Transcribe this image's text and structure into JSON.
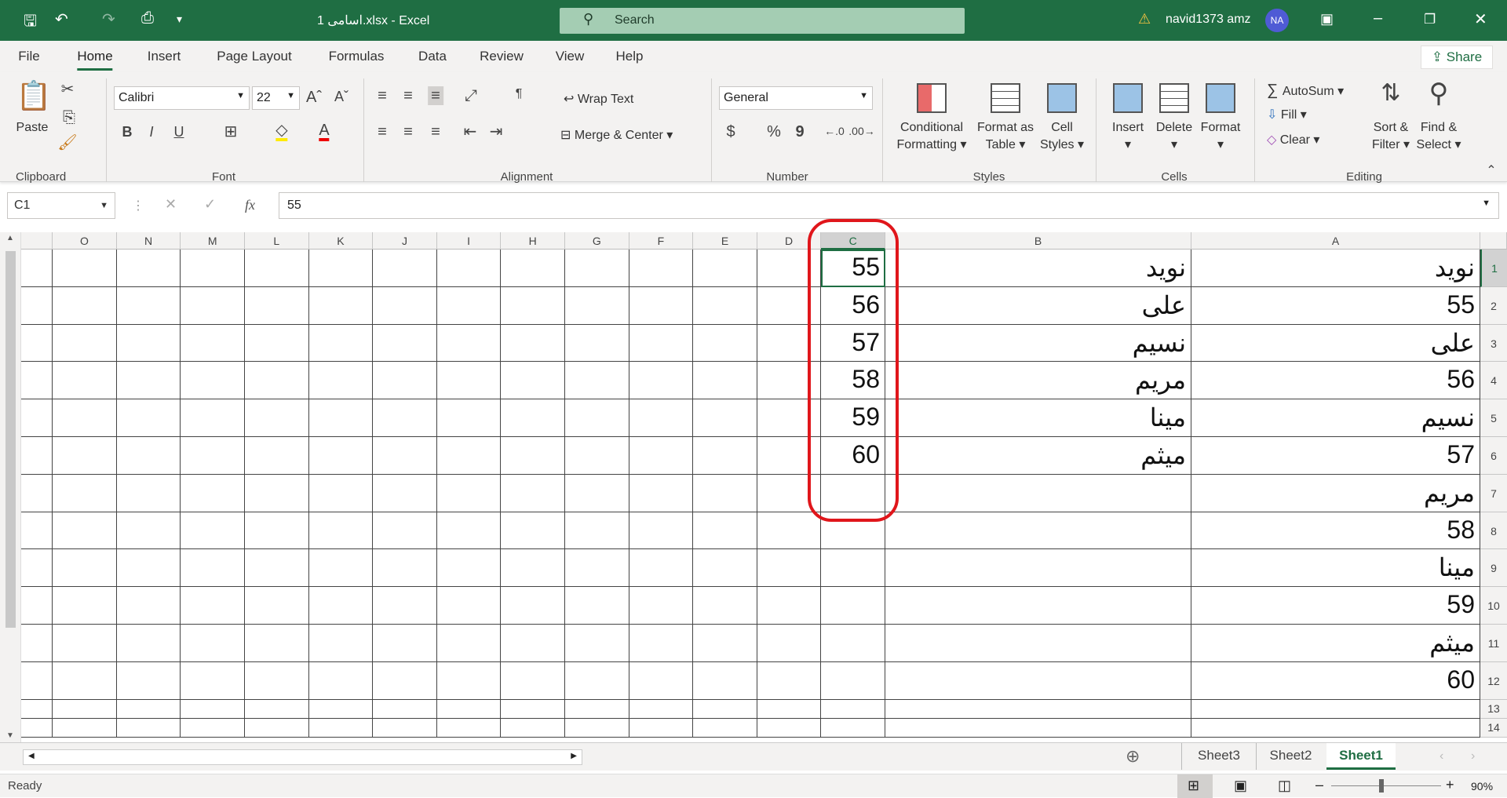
{
  "titlebar": {
    "title": "اسامی 1.xlsx - Excel",
    "search_placeholder": "Search",
    "user": "navid1373 amz",
    "avatar": "NA"
  },
  "tabs": [
    "File",
    "Home",
    "Insert",
    "Page Layout",
    "Formulas",
    "Data",
    "Review",
    "View",
    "Help"
  ],
  "active_tab": "Home",
  "share": "Share",
  "ribbon": {
    "clipboard": {
      "paste": "Paste",
      "label": "Clipboard"
    },
    "font": {
      "name": "Calibri",
      "size": "22",
      "bold": "B",
      "italic": "I",
      "underline": "U",
      "label": "Font"
    },
    "alignment": {
      "wrap": "Wrap Text",
      "merge": "Merge & Center",
      "label": "Alignment"
    },
    "number": {
      "format": "General",
      "currency": "$",
      "percent": "%",
      "comma": "9",
      "label": "Number"
    },
    "styles": {
      "cond1": "Conditional",
      "cond2": "Formatting",
      "fat1": "Format as",
      "fat2": "Table",
      "cs1": "Cell",
      "cs2": "Styles",
      "label": "Styles"
    },
    "cells": {
      "insert": "Insert",
      "delete": "Delete",
      "format": "Format",
      "label": "Cells"
    },
    "editing": {
      "autosum": "AutoSum",
      "fill": "Fill",
      "clear": "Clear",
      "sort1": "Sort &",
      "sort2": "Filter",
      "find1": "Find &",
      "find2": "Select",
      "label": "Editing"
    }
  },
  "formula_bar": {
    "name_box": "C1",
    "fx": "fx",
    "value": "55"
  },
  "sheet": {
    "columns": [
      "A",
      "B",
      "C",
      "D",
      "E",
      "F",
      "G",
      "H",
      "I",
      "J",
      "K",
      "L",
      "M",
      "N",
      "O"
    ],
    "rows": [
      "1",
      "2",
      "3",
      "4",
      "5",
      "6",
      "7",
      "8",
      "9",
      "10",
      "11",
      "12",
      "13",
      "14"
    ],
    "selected": "C1",
    "cells": {
      "A": [
        "نوید",
        "55",
        "علی",
        "56",
        "نسیم",
        "57",
        "مریم",
        "58",
        "مینا",
        "59",
        "میثم",
        "60"
      ],
      "B": [
        "نوید",
        "علی",
        "نسیم",
        "مریم",
        "مینا",
        "میثم"
      ],
      "C": [
        "55",
        "56",
        "57",
        "58",
        "59",
        "60"
      ]
    },
    "highlight_color": "#e0161b"
  },
  "sheet_tabs": [
    "Sheet3",
    "Sheet2",
    "Sheet1"
  ],
  "active_sheet": "Sheet1",
  "status": {
    "ready": "Ready",
    "zoom": "90%",
    "zoom_percent": 90
  }
}
